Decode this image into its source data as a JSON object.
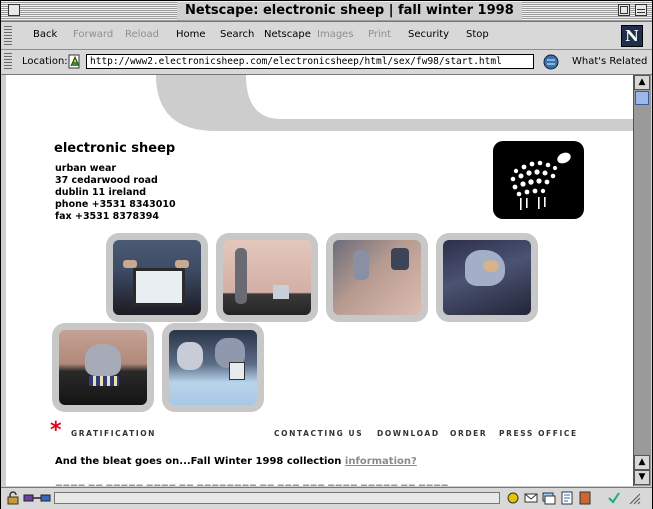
{
  "window": {
    "title": "Netscape: electronic sheep | fall winter 1998"
  },
  "toolbar": {
    "back": "Back",
    "forward": "Forward",
    "reload": "Reload",
    "home": "Home",
    "search": "Search",
    "netscape": "Netscape",
    "images": "Images",
    "print": "Print",
    "security": "Security",
    "stop": "Stop",
    "logo_letter": "N"
  },
  "location": {
    "label": "Location:",
    "url": "http://www2.electronicsheep.com/electronicsheep/html/sex/fw98/start.html",
    "whats_related": "What's Related"
  },
  "page": {
    "brand": "electronic sheep",
    "address_lines": [
      "urban wear",
      "37 cedarwood road",
      "dublin 11 ireland",
      "phone +3531 8343010",
      "fax +3531 8378394"
    ],
    "star": "*",
    "gratification": "GRATIFICATION",
    "nav_links": [
      "CONTACTING US",
      "DOWNLOAD",
      "ORDER",
      "PRESS OFFICE"
    ],
    "bleat_text": "And the bleat goes on...Fall Winter 1998 collection ",
    "bleat_link": "information?",
    "accent_color": "#e0001a"
  },
  "scrollbar": {
    "up": "▲",
    "down": "▼"
  }
}
